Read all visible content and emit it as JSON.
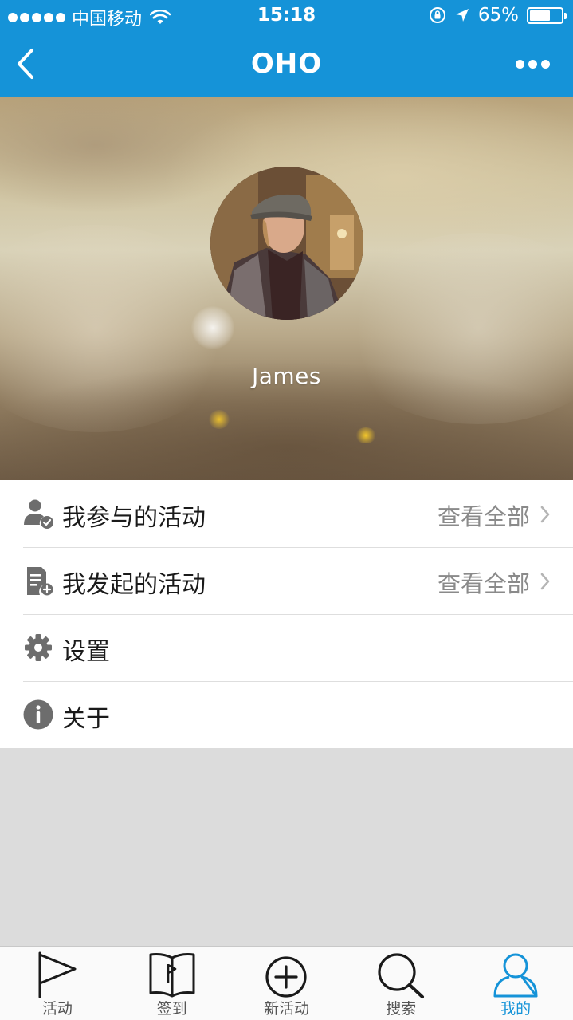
{
  "status_bar": {
    "carrier": "中国移动",
    "time": "15:18",
    "battery": "65%",
    "battery_level": 0.65
  },
  "nav": {
    "title": "OHO",
    "back_icon": "chevron-left-icon",
    "more_icon": "more-icon"
  },
  "profile": {
    "name": "James"
  },
  "menu": {
    "items": [
      {
        "label": "我参与的活动",
        "action": "查看全部",
        "icon": "user-check-icon"
      },
      {
        "label": "我发起的活动",
        "action": "查看全部",
        "icon": "document-add-icon"
      },
      {
        "label": "设置",
        "icon": "gear-icon"
      },
      {
        "label": "关于",
        "icon": "info-icon"
      }
    ]
  },
  "tabbar": {
    "active_index": 4,
    "tabs": [
      {
        "label": "活动",
        "icon": "flag-icon"
      },
      {
        "label": "签到",
        "icon": "book-flag-icon"
      },
      {
        "label": "新活动",
        "icon": "plus-circle-icon"
      },
      {
        "label": "搜索",
        "icon": "search-icon"
      },
      {
        "label": "我的",
        "icon": "person-icon"
      }
    ]
  },
  "colors": {
    "brand": "#1593d8",
    "icon_gray": "#6d6d6d",
    "background": "#dcdcdc"
  }
}
